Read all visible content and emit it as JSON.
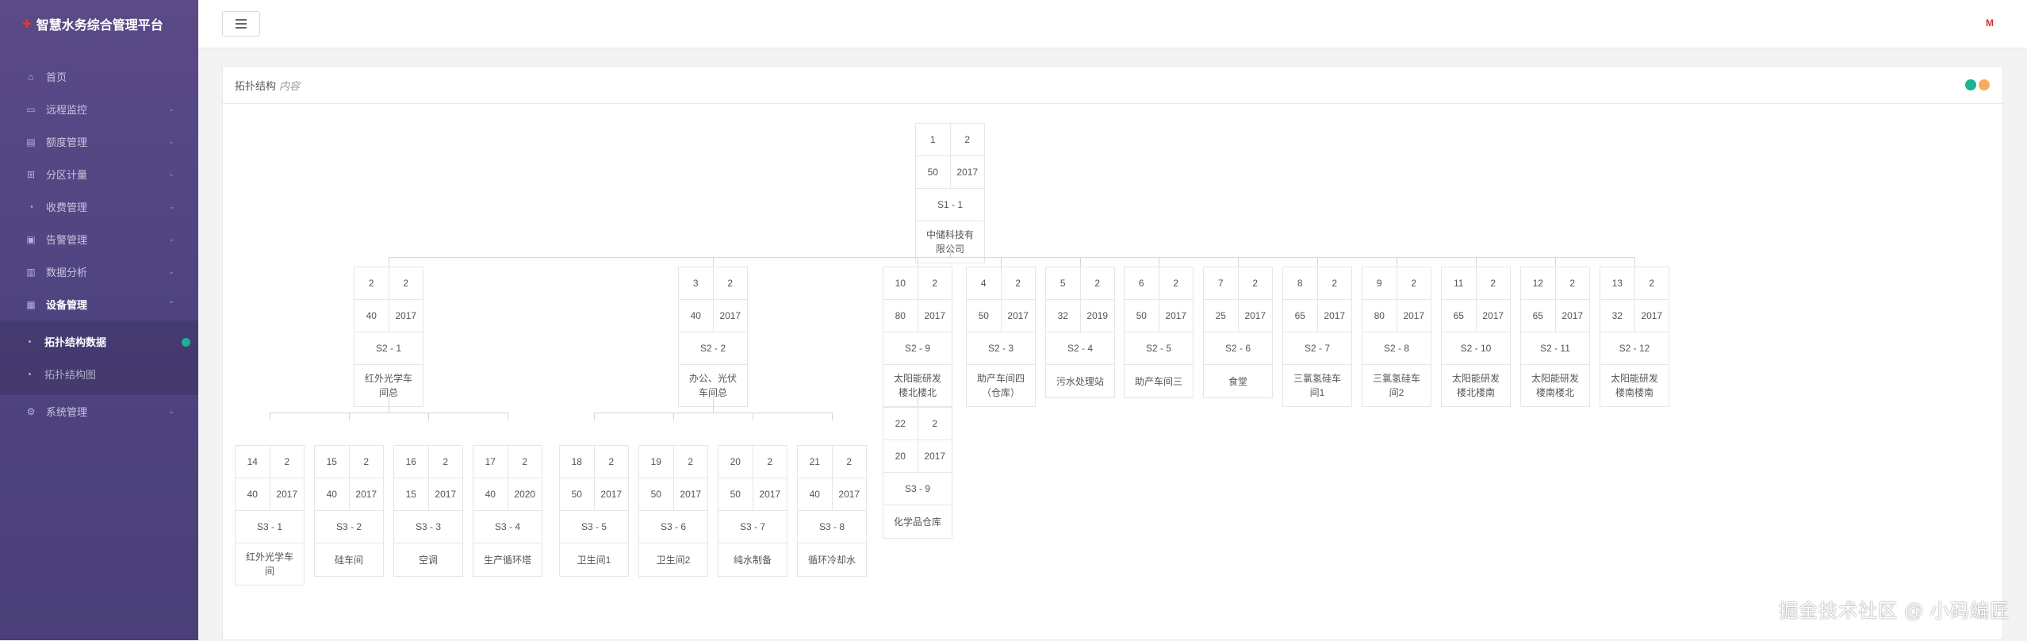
{
  "app": {
    "title": "智慧水务综合管理平台",
    "logo": "水"
  },
  "sidebar": {
    "items": [
      {
        "label": "首页",
        "icon": "home-icon",
        "chev": false
      },
      {
        "label": "远程监控",
        "icon": "monitor-icon",
        "chev": true
      },
      {
        "label": "额度管理",
        "icon": "quota-icon",
        "chev": true
      },
      {
        "label": "分区计量",
        "icon": "partition-icon",
        "chev": true
      },
      {
        "label": "收费管理",
        "icon": "billing-icon",
        "chev": true
      },
      {
        "label": "告警管理",
        "icon": "alarm-icon",
        "chev": true
      },
      {
        "label": "数据分析",
        "icon": "chart-icon",
        "chev": true
      },
      {
        "label": "设备管理",
        "icon": "device-icon",
        "chev": true
      },
      {
        "label": "系统管理",
        "icon": "settings-icon",
        "chev": true
      }
    ],
    "sub_items": [
      {
        "label": "拓扑结构数据"
      },
      {
        "label": "拓扑结构图"
      }
    ]
  },
  "panel": {
    "title": "拓扑结构",
    "subtitle": "内容"
  },
  "colors": {
    "tool1": "#1ab394",
    "tool2": "#f8ac59"
  },
  "topology": {
    "root": {
      "a": "1",
      "b": "2",
      "c": "50",
      "d": "2017",
      "code": "S1 - 1",
      "name": "中储科技有限公司"
    },
    "level2": [
      {
        "a": "2",
        "b": "2",
        "c": "40",
        "d": "2017",
        "code": "S2 - 1",
        "name": "红外光学车间总"
      },
      {
        "a": "3",
        "b": "2",
        "c": "40",
        "d": "2017",
        "code": "S2 - 2",
        "name": "办公、光伏车间总"
      },
      {
        "a": "10",
        "b": "2",
        "c": "80",
        "d": "2017",
        "code": "S2 - 9",
        "name": "太阳能研发楼北楼北"
      },
      {
        "a": "4",
        "b": "2",
        "c": "50",
        "d": "2017",
        "code": "S2 - 3",
        "name": "助产车间四（仓库）"
      },
      {
        "a": "5",
        "b": "2",
        "c": "32",
        "d": "2019",
        "code": "S2 - 4",
        "name": "污水处理站"
      },
      {
        "a": "6",
        "b": "2",
        "c": "50",
        "d": "2017",
        "code": "S2 - 5",
        "name": "助产车间三"
      },
      {
        "a": "7",
        "b": "2",
        "c": "25",
        "d": "2017",
        "code": "S2 - 6",
        "name": "食堂"
      },
      {
        "a": "8",
        "b": "2",
        "c": "65",
        "d": "2017",
        "code": "S2 - 7",
        "name": "三氯氢硅车间1"
      },
      {
        "a": "9",
        "b": "2",
        "c": "80",
        "d": "2017",
        "code": "S2 - 8",
        "name": "三氯氢硅车间2"
      },
      {
        "a": "11",
        "b": "2",
        "c": "65",
        "d": "2017",
        "code": "S2 - 10",
        "name": "太阳能研发楼北楼南"
      },
      {
        "a": "12",
        "b": "2",
        "c": "65",
        "d": "2017",
        "code": "S2 - 11",
        "name": "太阳能研发楼南楼北"
      },
      {
        "a": "13",
        "b": "2",
        "c": "32",
        "d": "2017",
        "code": "S2 - 12",
        "name": "太阳能研发楼南楼南"
      }
    ],
    "level3": [
      {
        "a": "14",
        "b": "2",
        "c": "40",
        "d": "2017",
        "code": "S3 - 1",
        "name": "红外光学车间"
      },
      {
        "a": "15",
        "b": "2",
        "c": "40",
        "d": "2017",
        "code": "S3 - 2",
        "name": "硅车间"
      },
      {
        "a": "16",
        "b": "2",
        "c": "15",
        "d": "2017",
        "code": "S3 - 3",
        "name": "空调"
      },
      {
        "a": "17",
        "b": "2",
        "c": "40",
        "d": "2020",
        "code": "S3 - 4",
        "name": "生产循环塔"
      },
      {
        "a": "18",
        "b": "2",
        "c": "50",
        "d": "2017",
        "code": "S3 - 5",
        "name": "卫生间1"
      },
      {
        "a": "19",
        "b": "2",
        "c": "50",
        "d": "2017",
        "code": "S3 - 6",
        "name": "卫生间2"
      },
      {
        "a": "20",
        "b": "2",
        "c": "50",
        "d": "2017",
        "code": "S3 - 7",
        "name": "纯水制备"
      },
      {
        "a": "21",
        "b": "2",
        "c": "40",
        "d": "2017",
        "code": "S3 - 8",
        "name": "循环冷却水"
      },
      {
        "a": "22",
        "b": "2",
        "c": "20",
        "d": "2017",
        "code": "S3 - 9",
        "name": "化学品仓库"
      }
    ]
  },
  "watermark": "掘金技术社区 @ 小码编匠"
}
